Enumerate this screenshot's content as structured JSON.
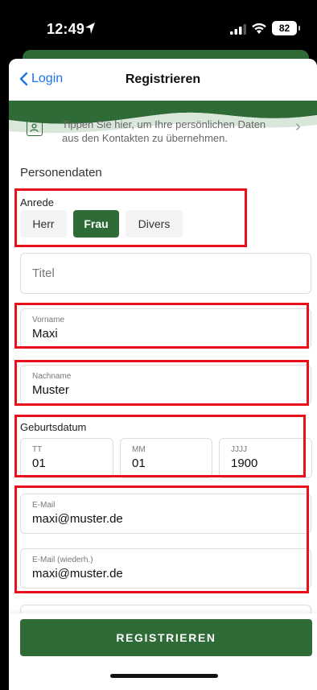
{
  "status_bar": {
    "time": "12:49",
    "battery": "82"
  },
  "nav": {
    "back_label": "Login",
    "title": "Registrieren"
  },
  "contacts_hint": "Tippen Sie hier, um Ihre persönlichen Daten aus den Kontakten zu übernehmen.",
  "section_title": "Personendaten",
  "anrede": {
    "label": "Anrede",
    "options": [
      "Herr",
      "Frau",
      "Divers"
    ],
    "selected": "Frau"
  },
  "titel": {
    "placeholder": "Titel",
    "value": ""
  },
  "vorname": {
    "label": "Vorname",
    "value": "Maxi"
  },
  "nachname": {
    "label": "Nachname",
    "value": "Muster"
  },
  "geburtsdatum": {
    "label": "Geburtsdatum",
    "day": {
      "label": "TT",
      "value": "01"
    },
    "month": {
      "label": "MM",
      "value": "01"
    },
    "year": {
      "label": "JJJJ",
      "value": "1900"
    }
  },
  "email": {
    "label": "E-Mail",
    "value": "maxi@muster.de"
  },
  "email_repeat": {
    "label": "E-Mail (wiederh.)",
    "value": "maxi@muster.de"
  },
  "submit_label": "REGISTRIEREN",
  "colors": {
    "accent": "#2f6b37",
    "link": "#1a73e8",
    "annotation": "#e8101a"
  }
}
